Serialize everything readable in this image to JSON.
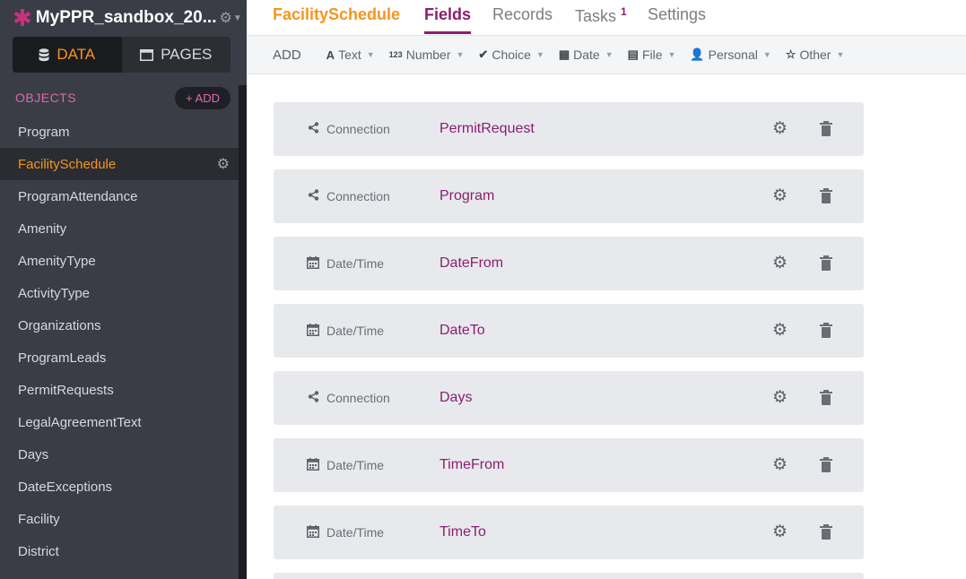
{
  "app": {
    "title": "MyPPR_sandbox_20...",
    "logo_icon": "asterisk-logo",
    "settings_icon": "gear-icon"
  },
  "mode_toggle": {
    "data_label": "DATA",
    "pages_label": "PAGES"
  },
  "objects": {
    "label": "OBJECTS",
    "add_label": "+ ADD",
    "items": [
      {
        "label": "Program"
      },
      {
        "label": "FacilitySchedule",
        "active": true
      },
      {
        "label": "ProgramAttendance"
      },
      {
        "label": "Amenity"
      },
      {
        "label": "AmenityType"
      },
      {
        "label": "ActivityType"
      },
      {
        "label": "Organizations"
      },
      {
        "label": "ProgramLeads"
      },
      {
        "label": "PermitRequests"
      },
      {
        "label": "LegalAgreementText"
      },
      {
        "label": "Days"
      },
      {
        "label": "DateExceptions"
      },
      {
        "label": "Facility"
      },
      {
        "label": "District"
      }
    ]
  },
  "topnav": {
    "object_name": "FacilitySchedule",
    "tabs": [
      {
        "label": "Fields",
        "active": true
      },
      {
        "label": "Records"
      },
      {
        "label": "Tasks",
        "badge": "1"
      },
      {
        "label": "Settings"
      }
    ]
  },
  "typebar": {
    "add_label": "ADD",
    "types": [
      {
        "label": "Text",
        "icon": "A"
      },
      {
        "label": "Number",
        "icon": "123"
      },
      {
        "label": "Choice",
        "icon": "✔"
      },
      {
        "label": "Date",
        "icon": "▦"
      },
      {
        "label": "File",
        "icon": "▤"
      },
      {
        "label": "Personal",
        "icon": "👤"
      },
      {
        "label": "Other",
        "icon": "☆"
      }
    ]
  },
  "fields": [
    {
      "type": "Connection",
      "name": "PermitRequest"
    },
    {
      "type": "Connection",
      "name": "Program"
    },
    {
      "type": "Date/Time",
      "name": "DateFrom"
    },
    {
      "type": "Date/Time",
      "name": "DateTo"
    },
    {
      "type": "Connection",
      "name": "Days"
    },
    {
      "type": "Date/Time",
      "name": "TimeFrom"
    },
    {
      "type": "Date/Time",
      "name": "TimeTo"
    }
  ],
  "colors": {
    "accent_orange": "#f7941e",
    "accent_purple": "#8a1f6e",
    "sidebar_bg": "#3a3d46"
  }
}
